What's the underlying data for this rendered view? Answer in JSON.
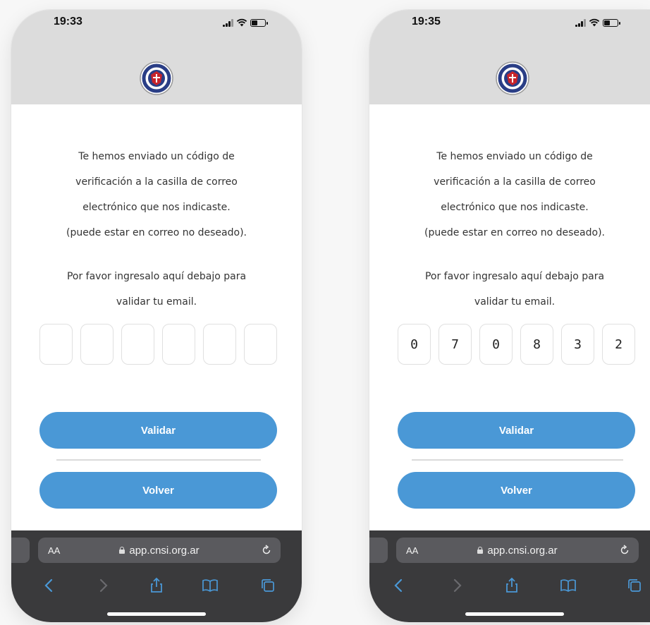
{
  "screens": [
    {
      "status": {
        "time": "19:33",
        "battery": "51"
      },
      "message": {
        "line1": "Te hemos enviado un código de",
        "line2": "verificación a la casilla de correo",
        "line3": "electrónico que nos indicaste.",
        "line4": "(puede estar en correo no deseado).",
        "line5": "Por favor ingresalo aquí debajo para",
        "line6": "validar tu email."
      },
      "code_digits": [
        "",
        "",
        "",
        "",
        "",
        ""
      ],
      "buttons": {
        "validate": "Validar",
        "back": "Volver"
      },
      "browser": {
        "text_size": "AA",
        "url": "app.cnsi.org.ar"
      }
    },
    {
      "status": {
        "time": "19:35",
        "battery": "51"
      },
      "message": {
        "line1": "Te hemos enviado un código de",
        "line2": "verificación a la casilla de correo",
        "line3": "electrónico que nos indicaste.",
        "line4": "(puede estar en correo no deseado).",
        "line5": "Por favor ingresalo aquí debajo para",
        "line6": "validar tu email."
      },
      "code_digits": [
        "0",
        "7",
        "0",
        "8",
        "3",
        "2"
      ],
      "buttons": {
        "validate": "Validar",
        "back": "Volver"
      },
      "browser": {
        "text_size": "AA",
        "url": "app.cnsi.org.ar"
      }
    }
  ],
  "colors": {
    "button": "#4a98d6",
    "header": "#dcdcdc",
    "toolbar": "#3a3a3c",
    "toolbar_icons": "#4a98d6"
  },
  "icons": [
    "signal-icon",
    "wifi-icon",
    "battery-icon",
    "club-logo",
    "lock-icon",
    "reload-icon",
    "back-icon",
    "forward-icon",
    "share-icon",
    "bookmarks-icon",
    "tabs-icon"
  ]
}
